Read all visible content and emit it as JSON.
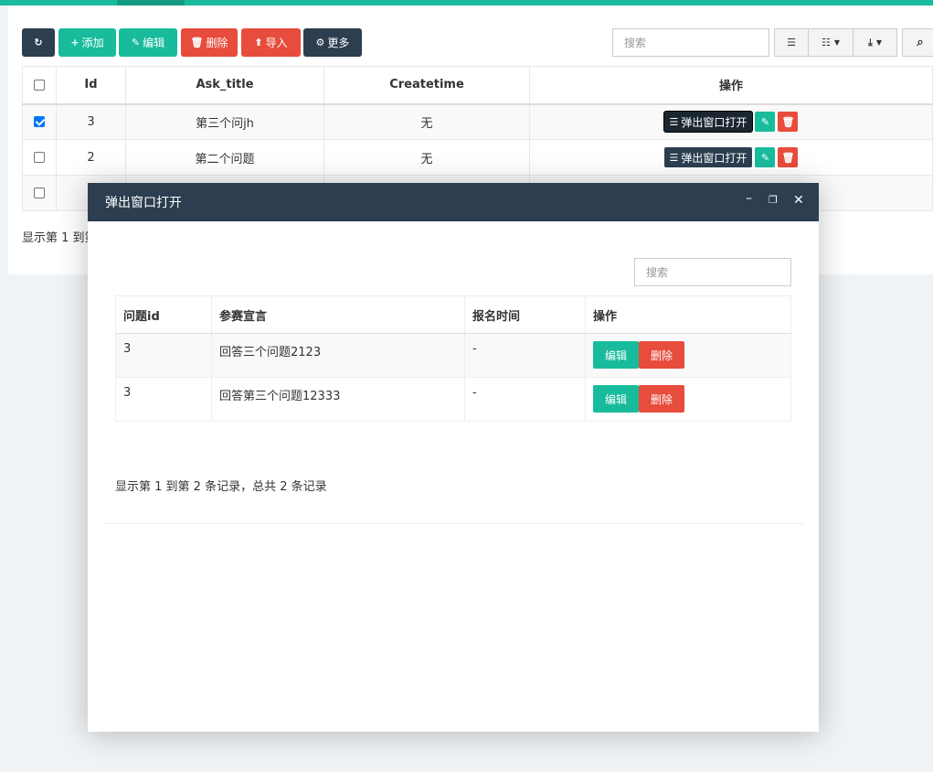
{
  "toolbar": {
    "refresh_icon": "refresh-icon",
    "add_label": "添加",
    "edit_label": "编辑",
    "delete_label": "删除",
    "import_label": "导入",
    "more_label": "更多",
    "search_placeholder": "搜索"
  },
  "table": {
    "headers": [
      "Id",
      "Ask_title",
      "Createtime",
      "操作"
    ],
    "rows": [
      {
        "id": "3",
        "title": "第三个问jh",
        "createtime": "无",
        "checked": true
      },
      {
        "id": "2",
        "title": "第二个问题",
        "createtime": "无",
        "checked": false
      }
    ],
    "popup_label": "弹出窗口打开"
  },
  "pagination_prefix": "显示第 1 到第",
  "modal": {
    "title": "弹出窗口打开",
    "search_placeholder": "搜索",
    "headers": [
      "问题id",
      "参赛宣言",
      "报名时间",
      "操作"
    ],
    "rows": [
      {
        "qid": "3",
        "declaration": "回答三个问题2123",
        "time": "-"
      },
      {
        "qid": "3",
        "declaration": "回答第三个问题12333",
        "time": "-"
      }
    ],
    "edit_label": "编辑",
    "delete_label": "删除",
    "pagination": "显示第 1 到第 2 条记录，总共 2 条记录"
  },
  "colors": {
    "primary": "#18bc9c",
    "dark": "#2c3e50",
    "danger": "#e74c3c"
  }
}
